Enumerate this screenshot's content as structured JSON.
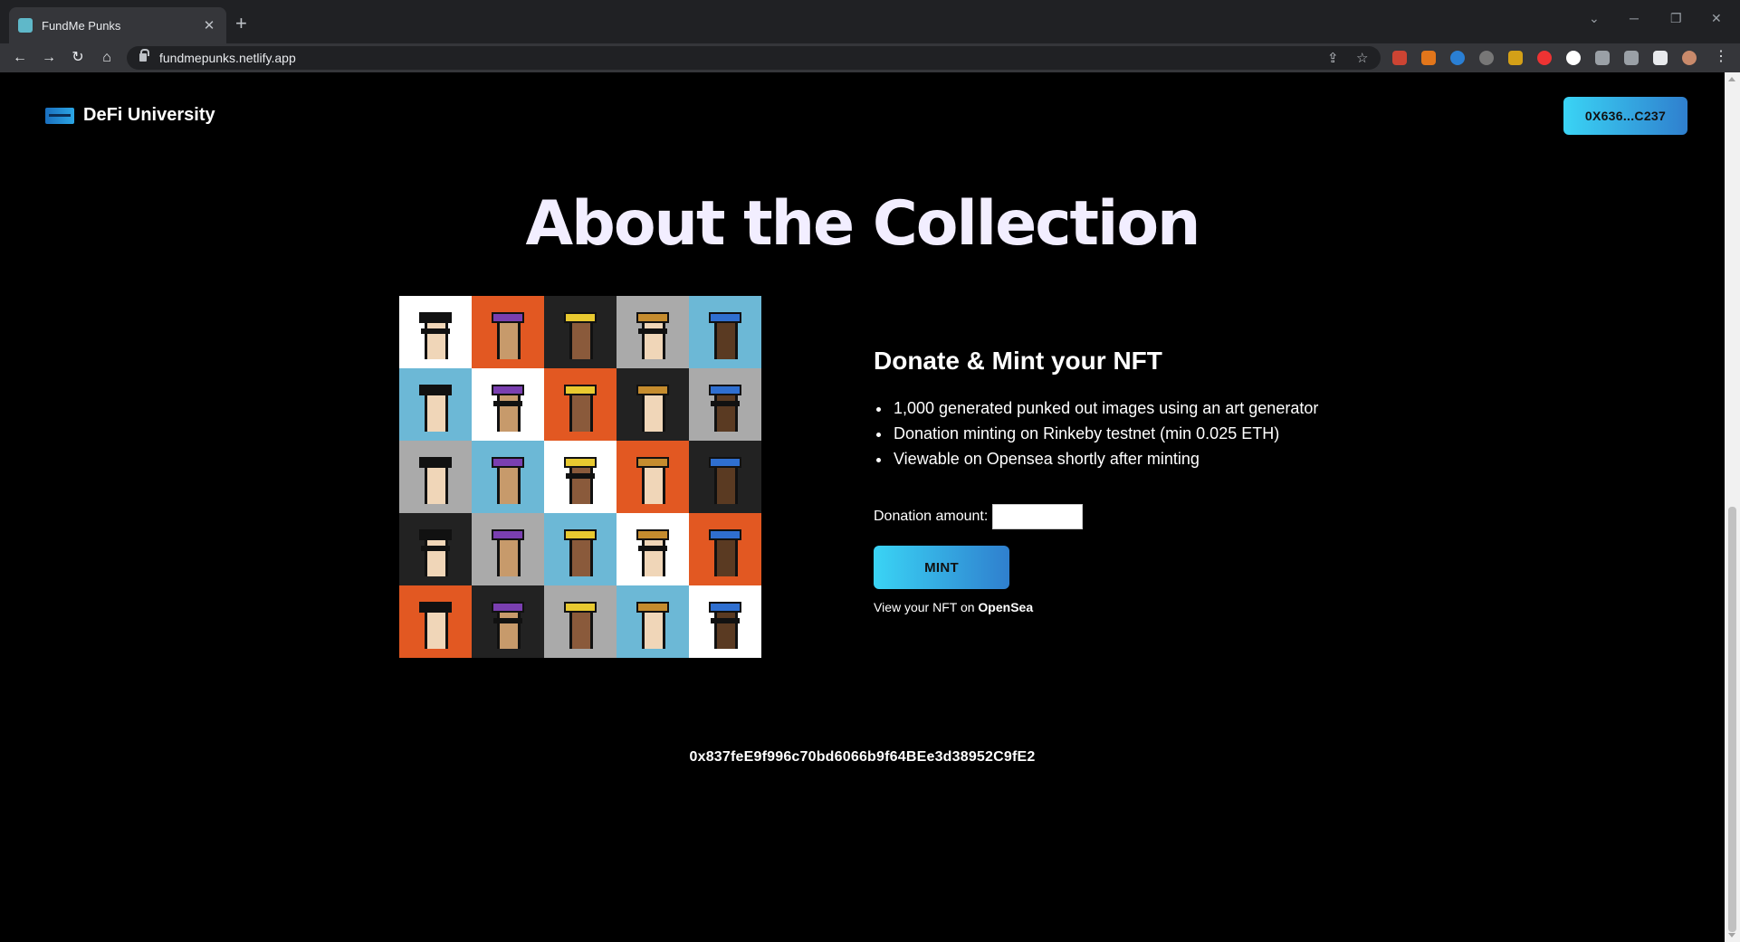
{
  "browser": {
    "tab_title": "FundMe Punks",
    "url": "fundmepunks.netlify.app",
    "tab_favicon_color": "#5fb8c9"
  },
  "header": {
    "brand_name": "DeFi University",
    "wallet_label": "0X636...C237"
  },
  "main": {
    "heading": "About the Collection",
    "mint_title": "Donate & Mint your NFT",
    "features": [
      "1,000 generated punked out images using an art generator",
      "Donation minting on Rinkeby testnet (min 0.025 ETH)",
      "Viewable on Opensea shortly after minting"
    ],
    "donation_label": "Donation amount:",
    "donation_value": "",
    "mint_label": "MINT",
    "view_prefix": "View your NFT on",
    "opensea_label": "OpenSea"
  },
  "footer": {
    "contract_address": "0x837feE9f996c70bd6066b9f64BEe3d38952C9fE2"
  },
  "theme": {
    "accent_gradient_start": "#3ad4f5",
    "accent_gradient_end": "#2f7fce",
    "background": "#000000"
  }
}
